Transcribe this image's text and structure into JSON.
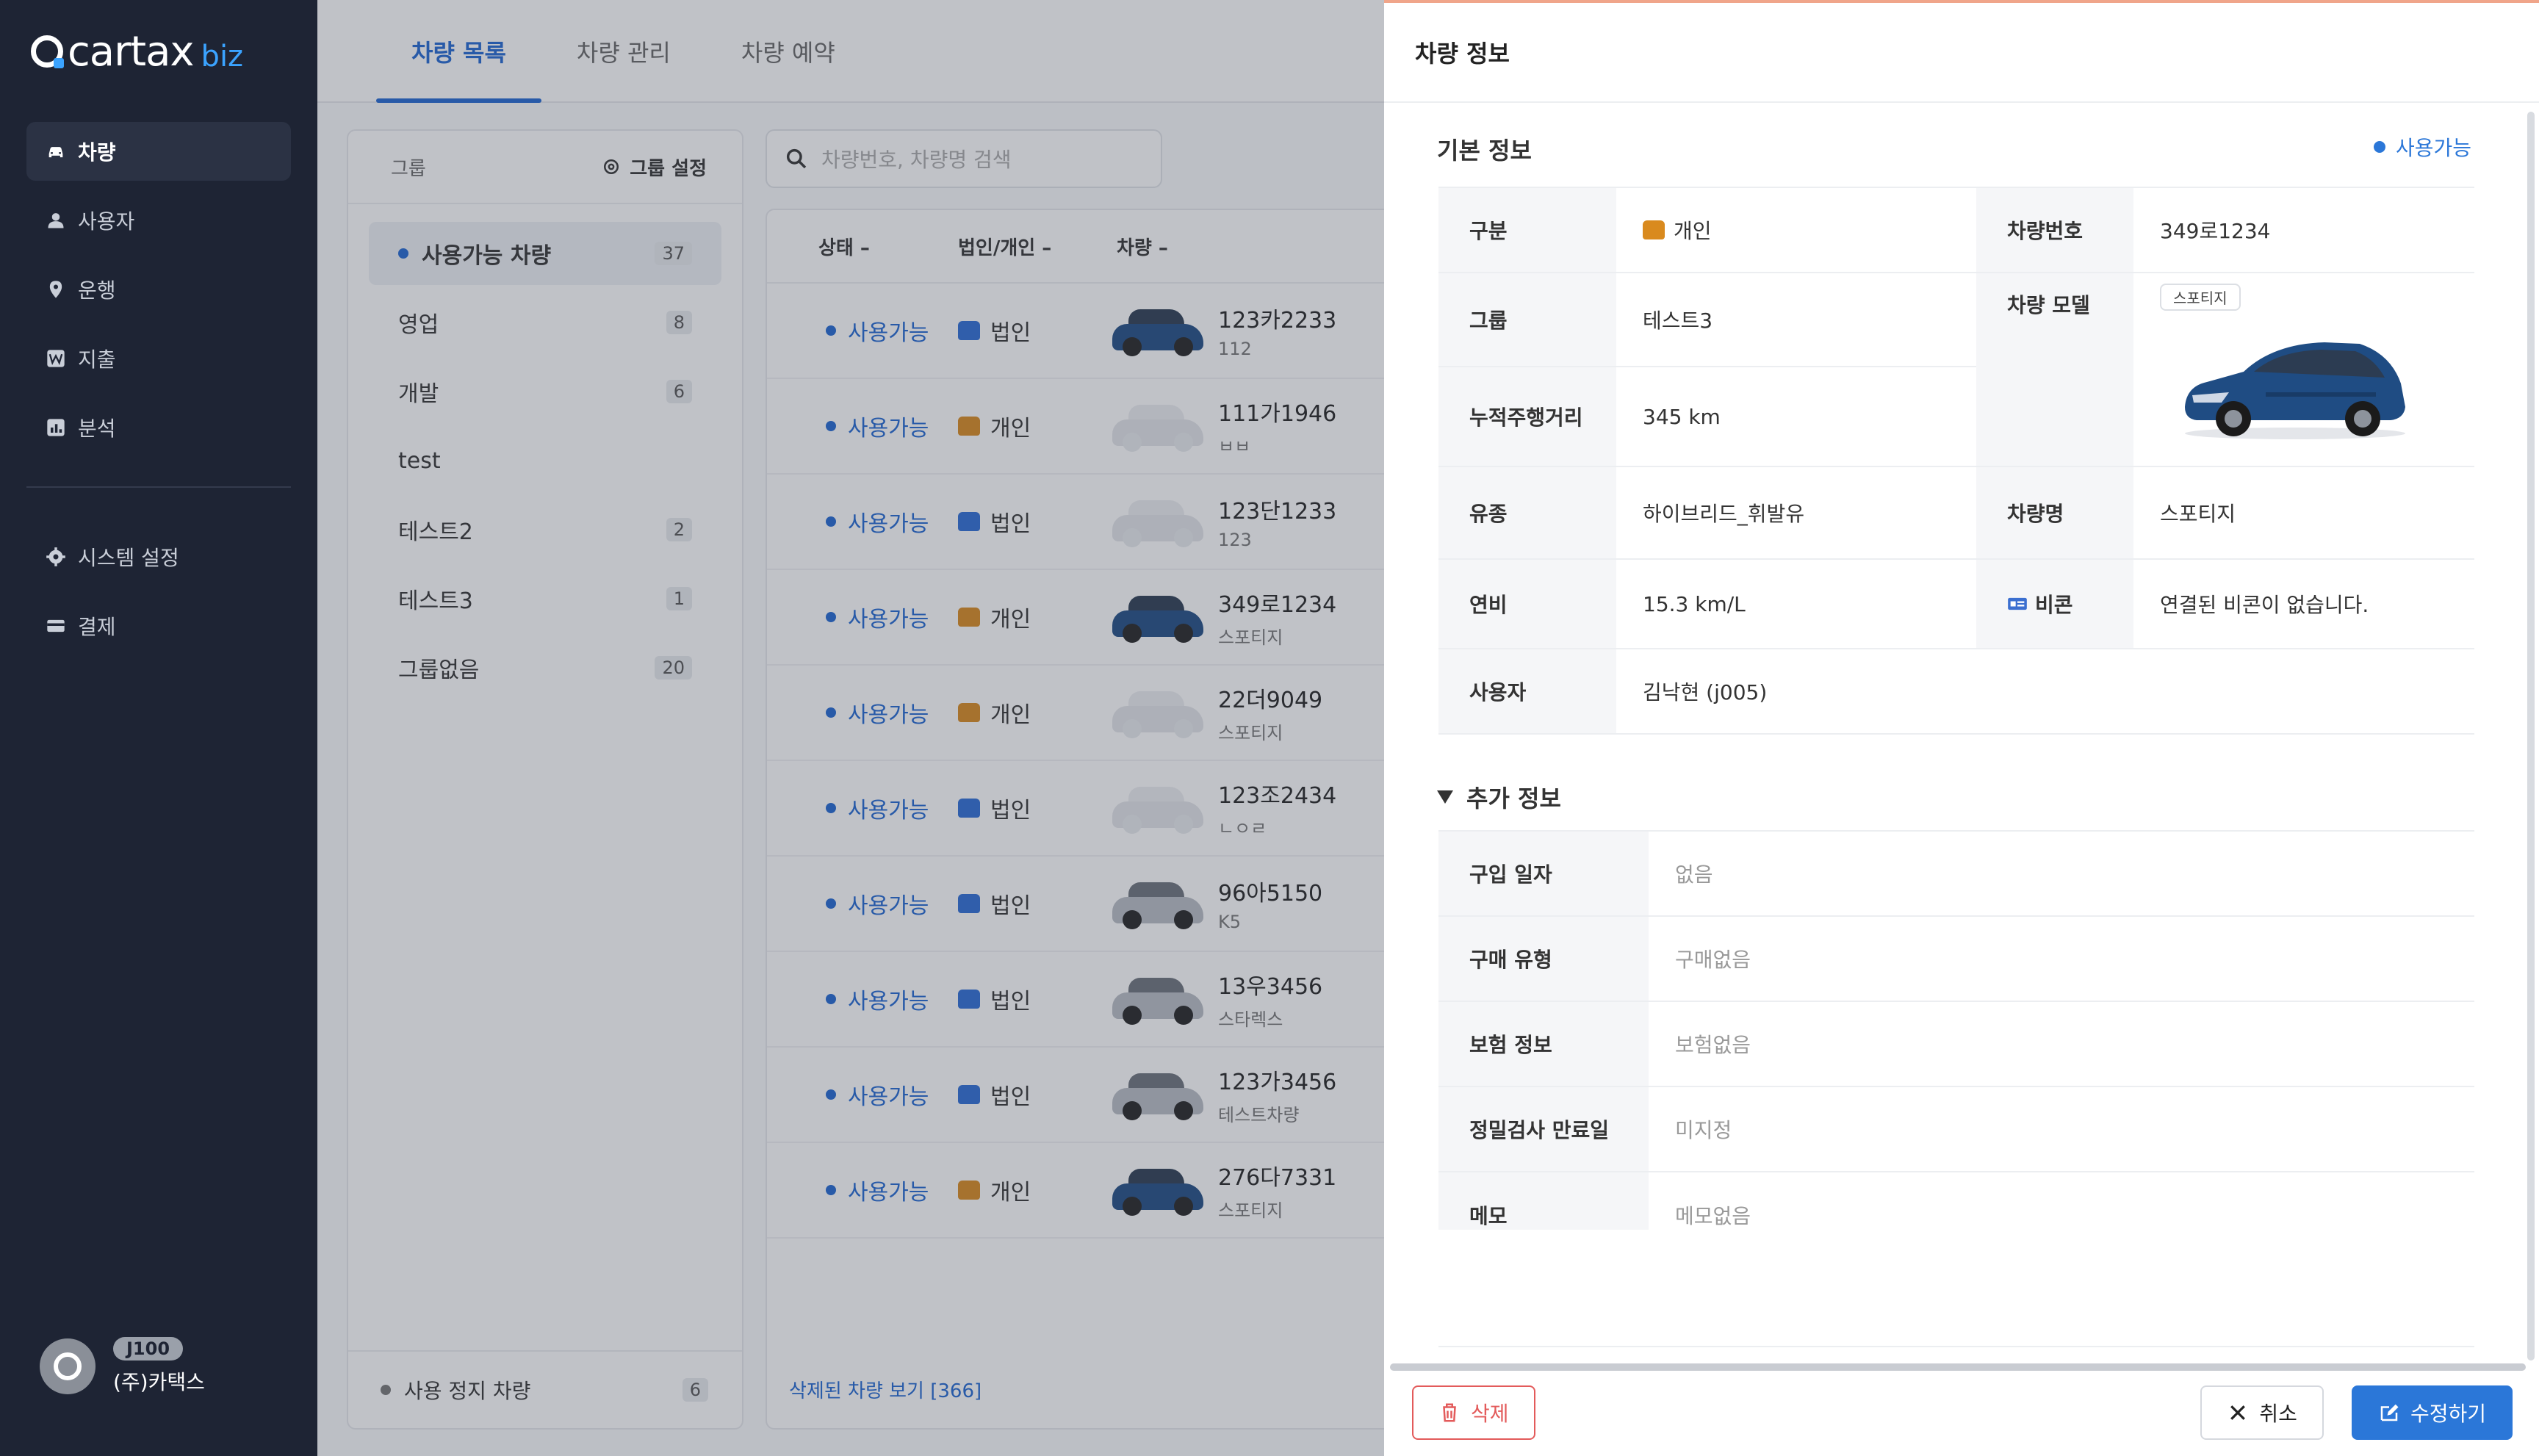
{
  "brand": {
    "name": "cartax",
    "suffix": "biz",
    "accent": "#3ba3ff"
  },
  "sidebar": {
    "items": [
      {
        "label": "차량",
        "icon": "car-icon",
        "active": true
      },
      {
        "label": "사용자",
        "icon": "user-icon",
        "active": false
      },
      {
        "label": "운행",
        "icon": "location-pin-icon",
        "active": false
      },
      {
        "label": "지출",
        "icon": "won-icon",
        "active": false
      },
      {
        "label": "분석",
        "icon": "chart-icon",
        "active": false
      }
    ],
    "bottom_items": [
      {
        "label": "시스템 설정",
        "icon": "gear-icon"
      },
      {
        "label": "결제",
        "icon": "card-icon"
      }
    ],
    "profile": {
      "badge": "J100",
      "company": "(주)카택스"
    }
  },
  "tabs": [
    {
      "label": "차량 목록",
      "active": true
    },
    {
      "label": "차량 관리",
      "active": false
    },
    {
      "label": "차량 예약",
      "active": false
    }
  ],
  "groups": {
    "header": "그룹",
    "settings_label": "그룹 설정",
    "items": [
      {
        "label": "사용가능 차량",
        "count": "37",
        "active": true
      },
      {
        "label": "영업",
        "count": "8"
      },
      {
        "label": "개발",
        "count": "6"
      },
      {
        "label": "test",
        "count": ""
      },
      {
        "label": "테스트2",
        "count": "2"
      },
      {
        "label": "테스트3",
        "count": "1"
      },
      {
        "label": "그룹없음",
        "count": "20"
      }
    ],
    "footer_label": "사용 정지 차량",
    "footer_count": "6"
  },
  "search": {
    "placeholder": "차량번호, 차량명 검색"
  },
  "list": {
    "columns": [
      "상태",
      "법인/개인",
      "차량"
    ],
    "rows": [
      {
        "state": "사용가능",
        "type": "법인",
        "plate": "123카2233",
        "sub": "112",
        "photo": "blue"
      },
      {
        "state": "사용가능",
        "type": "개인",
        "plate": "111가1946",
        "sub": "ㅂㅂ",
        "photo": "none"
      },
      {
        "state": "사용가능",
        "type": "법인",
        "plate": "123단1233",
        "sub": "123",
        "photo": "none"
      },
      {
        "state": "사용가능",
        "type": "개인",
        "plate": "349로1234",
        "sub": "스포티지",
        "photo": "blue"
      },
      {
        "state": "사용가능",
        "type": "개인",
        "plate": "22더9049",
        "sub": "스포티지",
        "photo": "none"
      },
      {
        "state": "사용가능",
        "type": "법인",
        "plate": "123조2434",
        "sub": "ㄴㅇㄹ",
        "photo": "none"
      },
      {
        "state": "사용가능",
        "type": "법인",
        "plate": "96아5150",
        "sub": "K5",
        "photo": "silver"
      },
      {
        "state": "사용가능",
        "type": "법인",
        "plate": "13우3456",
        "sub": "스타렉스",
        "photo": "silver"
      },
      {
        "state": "사용가능",
        "type": "법인",
        "plate": "123가3456",
        "sub": "테스트차량",
        "photo": "silver"
      },
      {
        "state": "사용가능",
        "type": "개인",
        "plate": "276다7331",
        "sub": "스포티지",
        "photo": "blue"
      }
    ],
    "deleted_link": "삭제된 차량 보기 [366]"
  },
  "drawer": {
    "title": "차량 정보",
    "basic_title": "기본 정보",
    "status": "사용가능",
    "basic": {
      "type_label": "구분",
      "type_value": "개인",
      "plate_label": "차량번호",
      "plate_value": "349로1234",
      "group_label": "그룹",
      "group_value": "테스트3",
      "model_label": "차량 모델",
      "model_badge": "스포티지",
      "mileage_label": "누적주행거리",
      "mileage_value": "345 km",
      "fuel_label": "유종",
      "fuel_value": "하이브리드_휘발유",
      "carname_label": "차량명",
      "carname_value": "스포티지",
      "efficiency_label": "연비",
      "efficiency_value": "15.3 km/L",
      "beacon_label": "비콘",
      "beacon_value": "연결된 비콘이 없습니다.",
      "user_label": "사용자",
      "user_value": "김낙현 (j005)"
    },
    "extra_title": "추가 정보",
    "extra": [
      {
        "label": "구입 일자",
        "value": "없음"
      },
      {
        "label": "구매 유형",
        "value": "구매없음"
      },
      {
        "label": "보험 정보",
        "value": "보험없음"
      },
      {
        "label": "정밀검사 만료일",
        "value": "미지정"
      },
      {
        "label": "메모",
        "value": "메모없음"
      }
    ],
    "buttons": {
      "delete": "삭제",
      "cancel": "취소",
      "edit": "수정하기"
    }
  }
}
